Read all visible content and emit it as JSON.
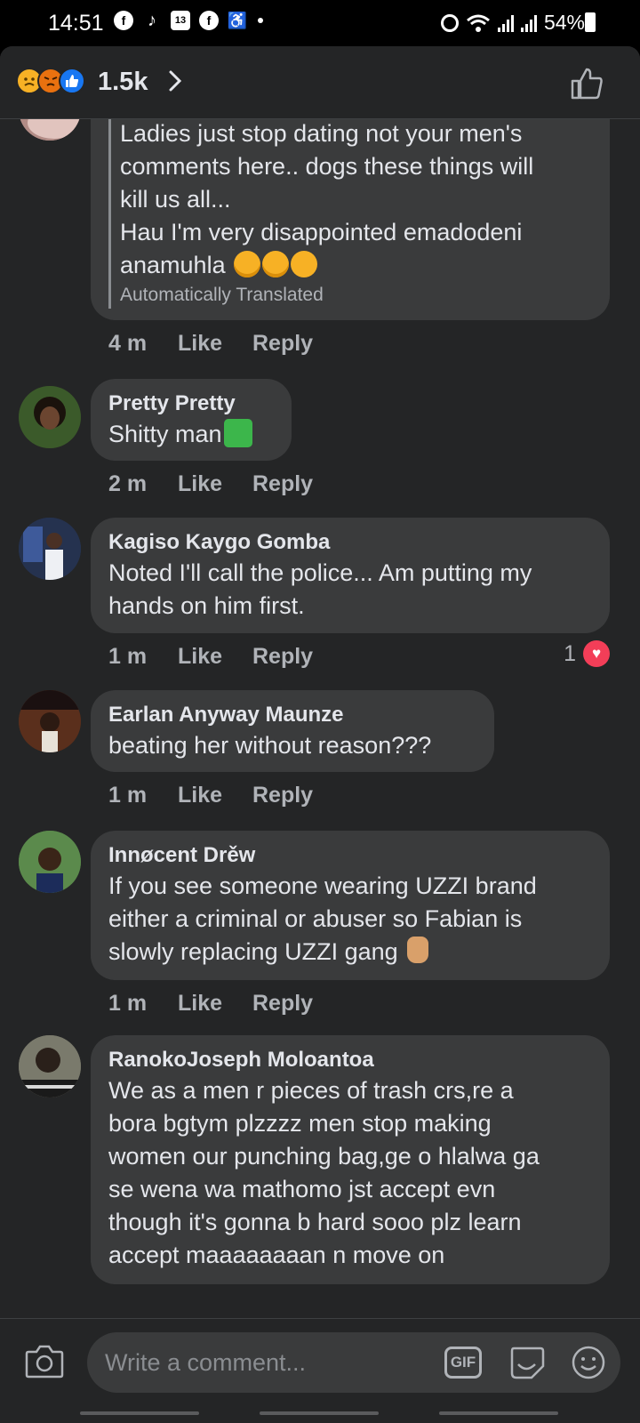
{
  "status_bar": {
    "time": "14:51",
    "battery": "54%"
  },
  "header": {
    "reaction_count": "1.5k",
    "reactions": [
      "sad",
      "angry",
      "like"
    ]
  },
  "comments": [
    {
      "lines": [
        "Ladies just stop dating not your men's",
        "comments here.. dogs these things will",
        "kill us all...",
        "Hau I'm very  disappointed emadodeni",
        "anamuhla"
      ],
      "translated_label": "Automatically Translated",
      "time": "4 m",
      "like": "Like",
      "reply": "Reply"
    },
    {
      "name": "Pretty Pretty",
      "text": "Shitty man",
      "time": "2 m",
      "like": "Like",
      "reply": "Reply"
    },
    {
      "name": "Kagiso Kaygo Gomba",
      "lines": [
        "Noted I'll call the police... Am putting my",
        "hands on him first."
      ],
      "time": "1 m",
      "like": "Like",
      "reply": "Reply",
      "reaction_count": "1"
    },
    {
      "name": "Earlan Anyway Maunze",
      "text": "beating her without reason???",
      "time": "1 m",
      "like": "Like",
      "reply": "Reply"
    },
    {
      "name": "Innøcent Drěw",
      "lines": [
        "If you see someone wearing UZZI brand",
        "either a criminal or abuser so Fabian is",
        "slowly replacing UZZI gang"
      ],
      "time": "1 m",
      "like": "Like",
      "reply": "Reply"
    },
    {
      "name": "RanokoJoseph Moloantoa",
      "lines": [
        "We as a men r pieces of trash crs,re a",
        "bora bgtym plzzzz men stop making",
        "women our punching bag,ge o hlalwa ga",
        "se wena wa mathomo jst accept evn",
        "though it's gonna b hard sooo plz learn",
        "accept maaaaaaaan n move on"
      ]
    }
  ],
  "composer": {
    "placeholder": "Write a comment...",
    "gif_label": "GIF"
  }
}
